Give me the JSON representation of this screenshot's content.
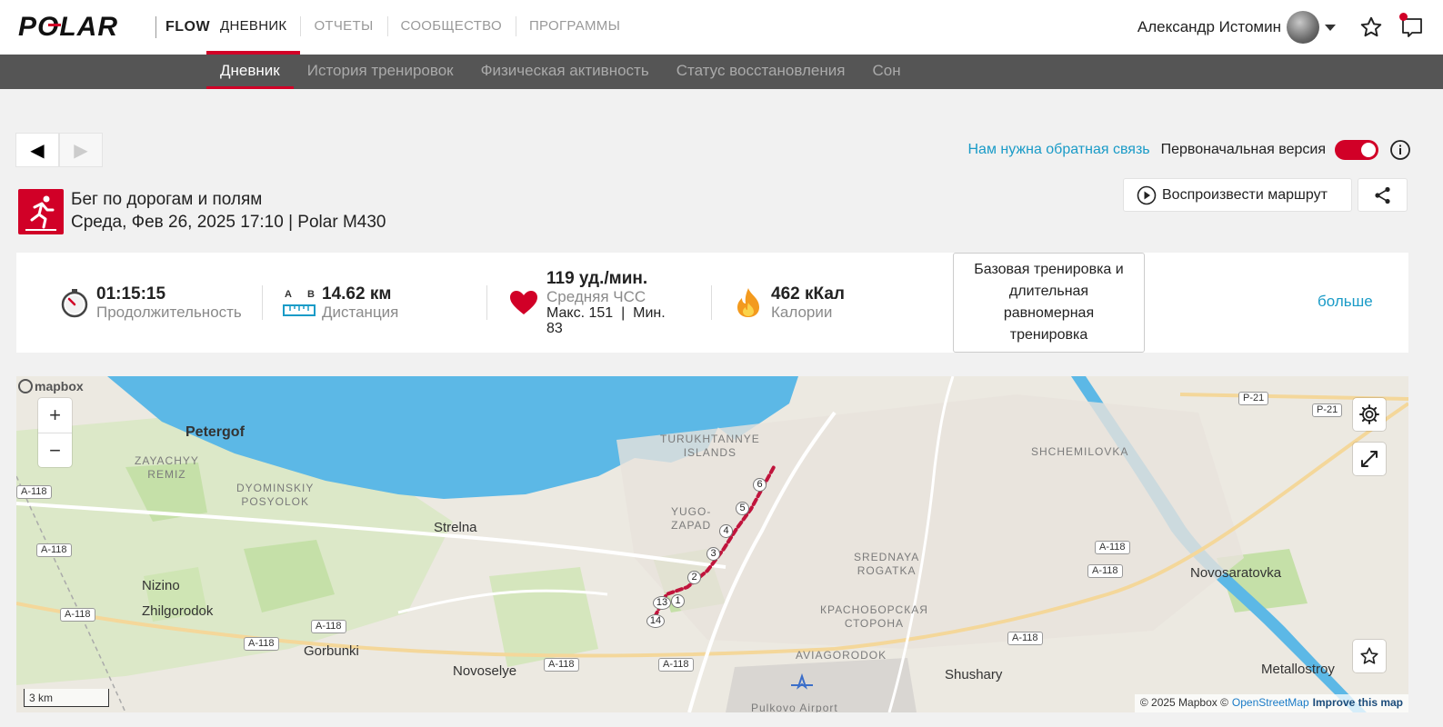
{
  "header": {
    "brand": "POLAR",
    "app": "FLOW",
    "nav": [
      {
        "label": "ДНЕВНИК",
        "active": true
      },
      {
        "label": "ОТЧЕТЫ",
        "active": false
      },
      {
        "label": "СООБЩЕСТВО",
        "active": false
      },
      {
        "label": "ПРОГРАММЫ",
        "active": false
      }
    ],
    "user_name": "Александр Истомин",
    "icons": [
      "user-avatar",
      "chevron-down-icon",
      "star-icon",
      "notifications-icon"
    ]
  },
  "subnav": [
    {
      "label": "Дневник",
      "active": true
    },
    {
      "label": "История тренировок",
      "active": false
    },
    {
      "label": "Физическая активность",
      "active": false
    },
    {
      "label": "Статус восстановления",
      "active": false
    },
    {
      "label": "Сон",
      "active": false
    }
  ],
  "pager": {
    "prev": "◀",
    "next": "▶"
  },
  "feedback": {
    "link": "Нам нужна обратная связь",
    "original_version": "Первоначальная версия",
    "toggle_on": true
  },
  "session": {
    "title": "Бег по дорогам и полям",
    "date": "Среда, Фев 26, 2025 17:10 | Polar M430",
    "replay": "Воспроизвести маршрут",
    "sport_icon": "running-icon"
  },
  "summary": {
    "duration": {
      "value": "01:15:15",
      "label": "Продолжительность"
    },
    "distance": {
      "value": "14.62 км",
      "label": "Дистанция",
      "a": "A",
      "b": "B"
    },
    "heart_rate": {
      "value": "119 уд./мин.",
      "label": "Средняя ЧСС",
      "sub1": "Макс. 151  |  Мин.",
      "sub2": "83"
    },
    "calories": {
      "value": "462 кКал",
      "label": "Калории"
    },
    "training_type": "Базовая тренировка и длительная равномерная тренировка",
    "more": "больше"
  },
  "map": {
    "places": [
      "Petergof",
      "Strelna",
      "Nizino",
      "Zhilgorodok",
      "Gorbunki",
      "Novoselye",
      "Shushary",
      "Novosaratovka",
      "Metallostroy"
    ],
    "districts": {
      "zayachyy": [
        "ZAYACHYY",
        "REMIZ"
      ],
      "dyominskiy": [
        "DYOMINSKIY",
        "POSYOLOK"
      ],
      "turukhtannye": [
        "TURUKHTANNYE",
        "ISLANDS"
      ],
      "yugo": [
        "YUGO-",
        "ZAPAD"
      ],
      "srednaya": [
        "SREDNAYA",
        "ROGATKA"
      ],
      "krasnoborskaya": [
        "КРАСНОБОРСКАЯ",
        "СТОРОНА"
      ],
      "aviagorodok": [
        "AVIAGORODOK"
      ],
      "shchemilovka": [
        "SHCHEMILOVKA"
      ],
      "pulkovo": [
        "Pulkovo Airport"
      ]
    },
    "roads": {
      "p21": "P-21",
      "a118": "A-118"
    },
    "laps": [
      "1",
      "2",
      "3",
      "4",
      "5",
      "6",
      "13",
      "14"
    ],
    "logo": "mapbox",
    "scale": "3 km",
    "attribution": {
      "copyright": "© 2025 Mapbox ©",
      "osm": "OpenStreetMap",
      "improve": "Improve this map"
    },
    "zoom_in": "+",
    "zoom_out": "−",
    "colors": {
      "water": "#5cb8e6",
      "park": "#c5e0a8",
      "route": "#c0143c"
    }
  },
  "colors": {
    "accent": "#d10027",
    "link": "#1a9bc7"
  }
}
